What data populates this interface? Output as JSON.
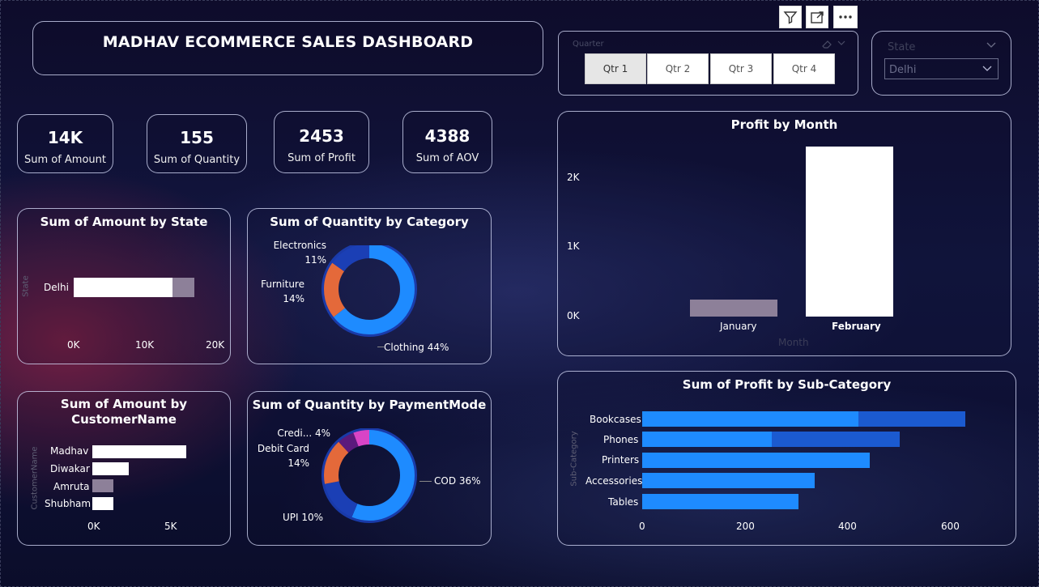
{
  "dashboard": {
    "title": "MADHAV ECOMMERCE SALES DASHBOARD"
  },
  "kpis": [
    {
      "value": "14K",
      "label": "Sum of Amount"
    },
    {
      "value": "155",
      "label": "Sum of Quantity"
    },
    {
      "value": "2453",
      "label": "Sum of Profit"
    },
    {
      "value": "4388",
      "label": "Sum of AOV"
    }
  ],
  "toolbar": {
    "icons": [
      "filter-icon",
      "focus-mode-icon",
      "more-options-icon"
    ]
  },
  "quarter_slicer": {
    "title": "Quarter",
    "options": [
      "Qtr 1",
      "Qtr 2",
      "Qtr 3",
      "Qtr 4"
    ],
    "selected": "Qtr 1"
  },
  "state_slicer": {
    "title": "State",
    "selected": "Delhi"
  },
  "amount_by_state": {
    "title": "Sum of Amount by State",
    "axis_title": "State",
    "ticks": [
      "0K",
      "10K",
      "20K"
    ]
  },
  "quantity_by_category": {
    "title": "Sum of Quantity by Category",
    "labels": {
      "electronics": "Electronics",
      "electronics_pct": "11%",
      "furniture": "Furniture",
      "furniture_pct": "14%",
      "clothing": "Clothing 44%"
    }
  },
  "amount_by_customer": {
    "title": "Sum of Amount by CustomerName",
    "title_line1": "Sum of Amount by",
    "title_line2": "CustomerName",
    "axis_title": "CustomerName",
    "ticks": [
      "0K",
      "5K"
    ]
  },
  "quantity_by_payment": {
    "title": "Sum of Quantity by PaymentMode",
    "labels": {
      "credit": "Credi... 4%",
      "debit": "Debit Card",
      "debit_pct": "14%",
      "cod": "COD 36%",
      "upi": "UPI 10%"
    }
  },
  "profit_by_month": {
    "title": "Profit by Month",
    "x_axis_title": "Month",
    "ticks": [
      "2K",
      "1K",
      "0K"
    ]
  },
  "profit_by_subcategory": {
    "title": "Sum of Profit by Sub-Category",
    "axis_title": "Sub-Category",
    "ticks": [
      "0",
      "200",
      "400",
      "600"
    ]
  },
  "colors": {
    "accent_blue": "#1e8bff",
    "dark_blue": "#1b3fb5",
    "orange": "#e4693a",
    "purple": "#5b1a7c",
    "pink": "#d844c6",
    "white_bar": "#ffffff",
    "muted_bar": "#8d8099"
  },
  "chart_data": [
    {
      "type": "bar",
      "title": "Sum of Amount by State",
      "orientation": "horizontal",
      "categories": [
        "Delhi"
      ],
      "series": [
        {
          "values": [
            14000
          ]
        }
      ],
      "ylabel": "State",
      "xlim": [
        0,
        20000
      ]
    },
    {
      "type": "pie",
      "title": "Sum of Quantity by Category",
      "categories": [
        "Clothing",
        "Furniture",
        "Electronics"
      ],
      "values": [
        44,
        14,
        11
      ],
      "value_labels": [
        "44%",
        "14%",
        "11%"
      ]
    },
    {
      "type": "bar",
      "title": "Sum of Amount by CustomerName",
      "orientation": "horizontal",
      "categories": [
        "Madhav",
        "Diwakar",
        "Amruta",
        "Shubham"
      ],
      "series": [
        {
          "values": [
            6200,
            2400,
            1400,
            1400
          ]
        }
      ],
      "ylabel": "CustomerName",
      "xlim": [
        0,
        8000
      ]
    },
    {
      "type": "pie",
      "title": "Sum of Quantity by PaymentMode",
      "categories": [
        "COD",
        "UPI",
        "Debit Card",
        "Credit Card"
      ],
      "values": [
        36,
        10,
        14,
        4
      ],
      "value_labels": [
        "36%",
        "10%",
        "14%",
        "4%"
      ]
    },
    {
      "type": "bar",
      "title": "Profit by Month",
      "categories": [
        "January",
        "February"
      ],
      "series": [
        {
          "values": [
            250,
            2450
          ]
        }
      ],
      "xlabel": "Month",
      "ylim": [
        0,
        2500
      ]
    },
    {
      "type": "bar",
      "title": "Sum of Profit by Sub-Category",
      "orientation": "horizontal",
      "categories": [
        "Bookcases",
        "Phones",
        "Printers",
        "Accessories",
        "Tables"
      ],
      "series": [
        {
          "values": [
            425,
            255,
            447,
            338,
            306
          ]
        },
        {
          "values": [
            630,
            505,
            0,
            0,
            0
          ]
        }
      ],
      "ylabel": "Sub-Category",
      "xlim": [
        0,
        650
      ]
    }
  ]
}
